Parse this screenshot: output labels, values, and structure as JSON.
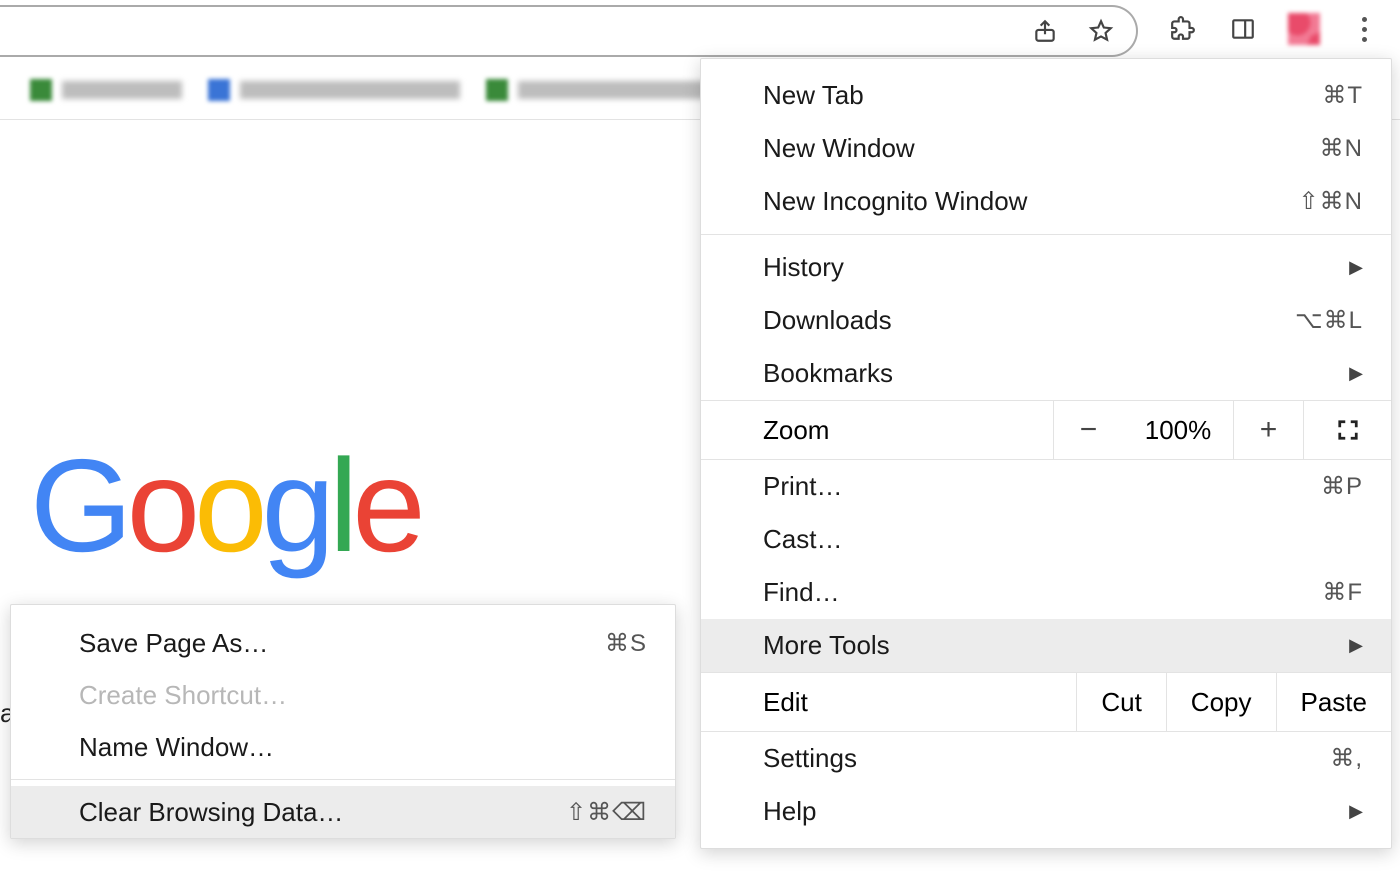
{
  "toolbar": {
    "share_icon": "share-icon",
    "star_icon": "star-icon",
    "extensions_icon": "puzzle-icon",
    "sidepanel_icon": "sidepanel-icon",
    "profile_icon": "profile-avatar",
    "menu_icon": "kebab-icon"
  },
  "menu": {
    "new_tab": {
      "label": "New Tab",
      "accel": "⌘T"
    },
    "new_window": {
      "label": "New Window",
      "accel": "⌘N"
    },
    "new_incognito": {
      "label": "New Incognito Window",
      "accel": "⇧⌘N"
    },
    "history": {
      "label": "History"
    },
    "downloads": {
      "label": "Downloads",
      "accel": "⌥⌘L"
    },
    "bookmarks": {
      "label": "Bookmarks"
    },
    "zoom": {
      "label": "Zoom",
      "minus": "−",
      "value": "100%",
      "plus": "+"
    },
    "print": {
      "label": "Print…",
      "accel": "⌘P"
    },
    "cast": {
      "label": "Cast…"
    },
    "find": {
      "label": "Find…",
      "accel": "⌘F"
    },
    "more_tools": {
      "label": "More Tools"
    },
    "edit": {
      "label": "Edit",
      "cut": "Cut",
      "copy": "Copy",
      "paste": "Paste"
    },
    "settings": {
      "label": "Settings",
      "accel": "⌘,"
    },
    "help": {
      "label": "Help"
    }
  },
  "submenu": {
    "save_page": {
      "label": "Save Page As…",
      "accel": "⌘S"
    },
    "create_shortcut": {
      "label": "Create Shortcut…"
    },
    "name_window": {
      "label": "Name Window…"
    },
    "clear_data": {
      "label": "Clear Browsing Data…",
      "accel": "⇧⌘⌫"
    }
  },
  "page": {
    "logo": {
      "g1": "G",
      "o1": "o",
      "o2": "o",
      "g2": "g",
      "l1": "l",
      "e1": "e"
    },
    "stray": "a"
  }
}
